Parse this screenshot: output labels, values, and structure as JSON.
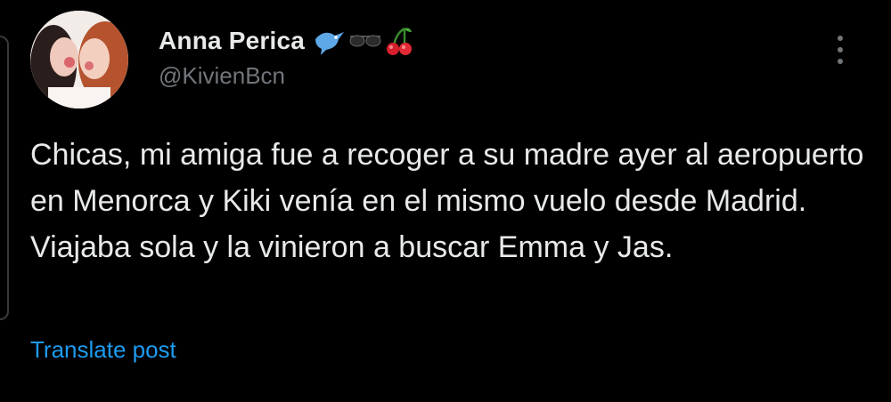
{
  "post": {
    "author": {
      "display_name": "Anna Perica",
      "handle": "@KivienBcn",
      "name_emoji_icons": [
        "bird-icon",
        "sunglasses-icon",
        "cherries-icon"
      ]
    },
    "text": "Chicas, mi amiga fue a recoger a su madre ayer al aeropuerto en Menorca y Kiki venía en el mismo vuelo desde Madrid. Viajaba sola y la vinieron a buscar Emma y Jas.",
    "translate_label": "Translate post"
  },
  "colors": {
    "background": "#000000",
    "primary_text": "#e7e9ea",
    "secondary_text": "#71767b",
    "link": "#1d9bf0"
  }
}
